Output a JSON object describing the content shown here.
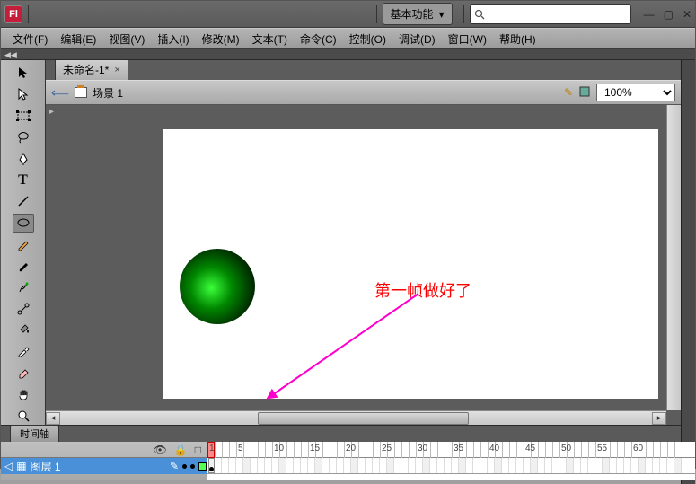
{
  "app": {
    "icon_letter": "Fl"
  },
  "workspace": {
    "label": "基本功能"
  },
  "search": {
    "placeholder": ""
  },
  "menus": {
    "file": "文件(F)",
    "edit": "编辑(E)",
    "view": "视图(V)",
    "insert": "插入(I)",
    "modify": "修改(M)",
    "text": "文本(T)",
    "commands": "命令(C)",
    "control": "控制(O)",
    "debug": "调试(D)",
    "window": "窗口(W)",
    "help": "帮助(H)"
  },
  "doc": {
    "tab_title": "未命名-1*",
    "scene_label": "场景 1",
    "zoom": "100%"
  },
  "timeline": {
    "tab_label": "时间轴",
    "layer_name": "图层 1",
    "ticks": [
      1,
      5,
      10,
      15,
      20,
      25,
      30,
      35,
      40,
      45,
      50,
      55,
      60
    ]
  },
  "annotation": {
    "text": "第一帧做好了"
  },
  "icons": {
    "eye": "👁",
    "lock": "🔒",
    "outline": "□",
    "pencil": "✎",
    "layer_nav": "◁"
  },
  "accent": {
    "layer_selected": "#4a90d9",
    "playhead": "#ff8888"
  }
}
